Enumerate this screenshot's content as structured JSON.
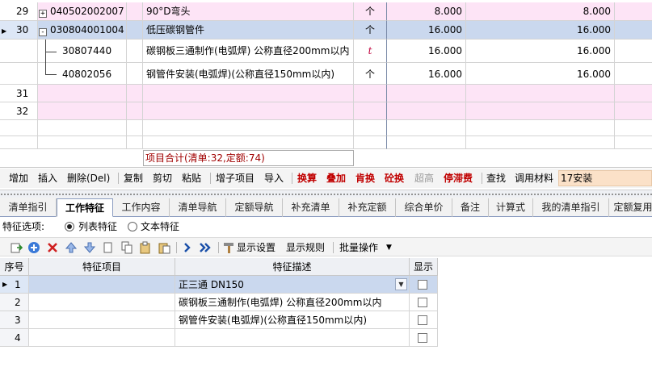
{
  "top_grid": {
    "rows": [
      {
        "no": "29",
        "expander": "+",
        "code": "040502002007",
        "name": "90°D弯头",
        "unit": "个",
        "qty1": "8.000",
        "qty2": "8.000"
      },
      {
        "no": "30",
        "expander": "-",
        "code": "030804001004",
        "name": "低压碳钢管件",
        "unit": "个",
        "qty1": "16.000",
        "qty2": "16.000"
      },
      {
        "code": "30807440",
        "name": "碳钢板三通制作(电弧焊) 公称直径200mm以内",
        "unit": "t",
        "qty1": "16.000",
        "qty2": "16.000"
      },
      {
        "code": "40802056",
        "name": "钢管件安装(电弧焊)(公称直径150mm以内)",
        "unit": "个",
        "qty1": "16.000",
        "qty2": "16.000"
      },
      {
        "no": "31"
      },
      {
        "no": "32"
      }
    ],
    "summary": "项目合计(清单:32,定额:74)"
  },
  "action_bar": {
    "add": "增加",
    "insert": "插入",
    "delete": "删除(Del)",
    "copy": "复制",
    "cut": "剪切",
    "paste": "粘贴",
    "add_sub": "增子项目",
    "import": "导入",
    "swap_calc": "换算",
    "stack": "叠加",
    "swap_ken": "肯换",
    "swap_concrete": "砼换",
    "over_height": "超高",
    "stagnation": "停滞费",
    "find": "查找",
    "use_material": "调用材料",
    "library": "17安装"
  },
  "tabs": [
    "清单指引",
    "工作特征",
    "工作内容",
    "清单导航",
    "定额导航",
    "补充清单",
    "补充定额",
    "综合单价",
    "备注",
    "计算式",
    "我的清单指引",
    "定额复用"
  ],
  "feature_options": {
    "label": "特征选项:",
    "list_feature": "列表特征",
    "text_feature": "文本特征",
    "selected": "list_feature"
  },
  "icon_toolbar": {
    "show_settings": "显示设置",
    "show_rules": "显示规则",
    "batch_ops": "批量操作"
  },
  "feature_grid": {
    "headers": {
      "no": "序号",
      "item": "特征项目",
      "desc": "特征描述",
      "show": "显示"
    },
    "rows": [
      {
        "no": "1",
        "item": "",
        "desc": "正三通 DN150"
      },
      {
        "no": "2",
        "item": "",
        "desc": "碳钢板三通制作(电弧焊) 公称直径200mm以内"
      },
      {
        "no": "3",
        "item": "",
        "desc": "钢管件安装(电弧焊)(公称直径150mm以内)"
      },
      {
        "no": "4",
        "item": "",
        "desc": ""
      }
    ]
  },
  "colors": {
    "pink_row": "#fde4f6",
    "selected_row": "#cad8ee",
    "accent_red": "#c00000",
    "library_bg": "#fbe1c8"
  }
}
